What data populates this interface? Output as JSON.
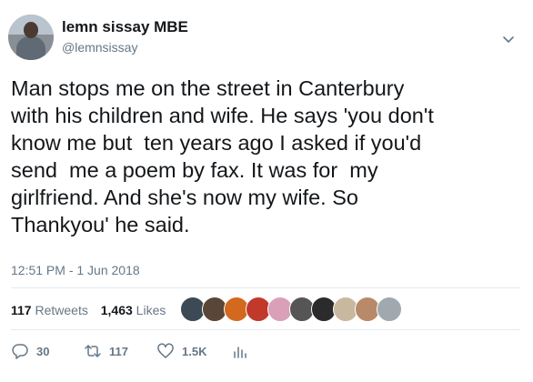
{
  "author": {
    "display_name": "lemn sissay MBE",
    "handle": "@lemnsissay"
  },
  "tweet": {
    "text": "Man stops me on the street in Canterbury\nwith his children and wife. He says 'you don't\nknow me but  ten years ago I asked if you'd\nsend  me a poem by fax. It was for  my\ngirlfriend. And she's now my wife. So\nThankyou' he said.",
    "timestamp": "12:51 PM - 1 Jun 2018"
  },
  "stats": {
    "retweets_count": "117",
    "retweets_label": "Retweets",
    "likes_count": "1,463",
    "likes_label": "Likes"
  },
  "likers": [
    {
      "name": "liker-avatar",
      "color": "#3b4a54"
    },
    {
      "name": "liker-avatar",
      "color": "#5a4636"
    },
    {
      "name": "liker-avatar",
      "color": "#d2691e"
    },
    {
      "name": "liker-avatar",
      "color": "#c0392b"
    },
    {
      "name": "liker-avatar",
      "color": "#d9a0b8"
    },
    {
      "name": "liker-avatar",
      "color": "#555555"
    },
    {
      "name": "liker-avatar",
      "color": "#2b2b2b"
    },
    {
      "name": "liker-avatar",
      "color": "#c9b8a0"
    },
    {
      "name": "liker-avatar",
      "color": "#b88a6a"
    },
    {
      "name": "liker-avatar",
      "color": "#a0a8b0"
    }
  ],
  "actions": {
    "reply_count": "30",
    "retweet_count": "117",
    "like_count": "1.5K"
  },
  "colors": {
    "secondary_text": "#657786",
    "primary_text": "#14171a",
    "divider": "#e6ecf0"
  }
}
